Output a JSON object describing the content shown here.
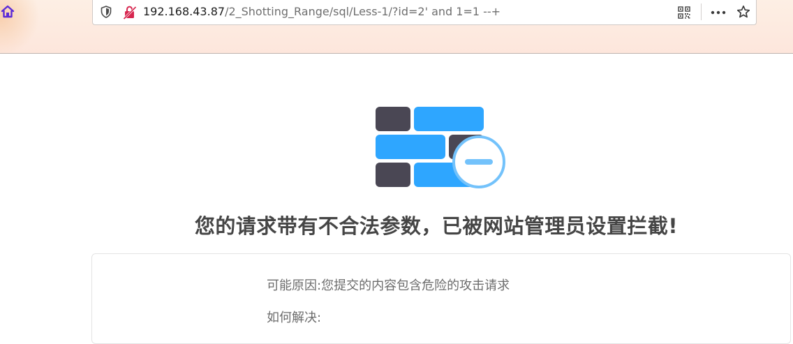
{
  "browser": {
    "url": {
      "host": "192.168.43.87",
      "path": "/2_Shotting_Range/sql/Less-1/?id=2' and 1=1 --+"
    },
    "icons": {
      "home": "home-icon",
      "shield": "tracking-protection-shield-icon",
      "insecure": "insecure-connection-lock-icon",
      "qr": "qr-code-icon",
      "more": "more-options-icon",
      "bookmark": "bookmark-star-icon"
    },
    "colors": {
      "home_icon": "#5b2bd8",
      "insecure_icon": "#d7264f",
      "toolbar_bg": "#fdebe0"
    }
  },
  "page": {
    "icon": "firewall-block-icon",
    "title": "您的请求带有不合法参数，已被网站管理员设置拦截!",
    "reason_label": "可能原因:",
    "reason_text": "您提交的内容包含危险的攻击请求",
    "solution_label": "如何解决:",
    "colors": {
      "brick_dark": "#4a4754",
      "brick_blue": "#2ea6ff",
      "badge_ring": "#73c2fb",
      "title": "#454545",
      "body_text": "#6c6c6c"
    }
  }
}
